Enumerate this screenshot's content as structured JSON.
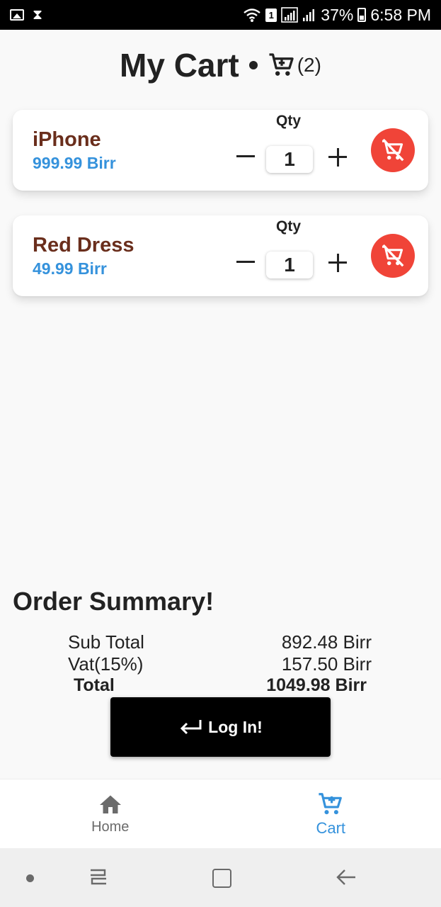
{
  "status_bar": {
    "battery": "37%",
    "time": "6:58 PM",
    "sim_label": "1"
  },
  "header": {
    "title": "My Cart",
    "cart_count": "(2)"
  },
  "cart": {
    "items": [
      {
        "name": "iPhone",
        "price": "999.99 Birr",
        "qty_label": "Qty",
        "qty": "1"
      },
      {
        "name": "Red Dress",
        "price": "49.99 Birr",
        "qty_label": "Qty",
        "qty": "1"
      }
    ]
  },
  "summary": {
    "title": "Order Summary!",
    "subtotal_label": "Sub Total",
    "subtotal_value": "892.48 Birr",
    "vat_label": "Vat(15%)",
    "vat_value": "157.50 Birr",
    "total_label": "Total",
    "total_value": "1049.98 Birr"
  },
  "login_button": {
    "label": "Log In!"
  },
  "bottom_nav": {
    "home_label": "Home",
    "cart_label": "Cart",
    "active": "cart"
  },
  "colors": {
    "item_name": "#6a2e1c",
    "price_accent": "#3592dc",
    "remove_button": "#f04438",
    "login_button": "#000000",
    "nav_active": "#3592dc"
  },
  "icons": {
    "header": "shopping-cart-icon",
    "remove": "remove-from-cart-icon",
    "login": "enter-arrow-icon",
    "nav_home": "home-icon",
    "nav_cart": "add-to-cart-icon"
  }
}
